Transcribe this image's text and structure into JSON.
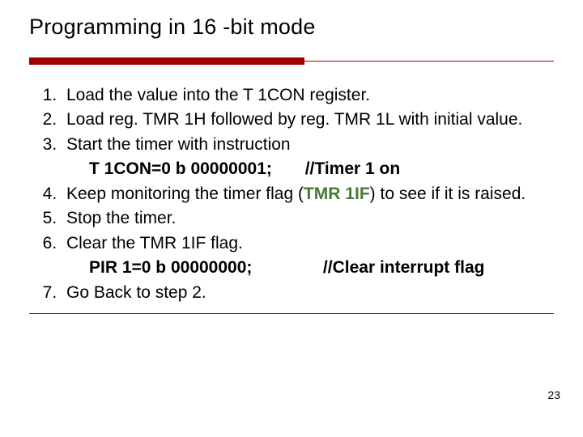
{
  "title": "Programming in 16 -bit mode",
  "steps": {
    "s1": "Load the value into the T 1CON register.",
    "s2": "Load reg. TMR 1H followed by reg. TMR 1L with initial value.",
    "s3": "Start the timer with instruction",
    "s3_code": "T 1CON=0 b 00000001;",
    "s3_comment": "//Timer 1 on",
    "s4_a": "Keep monitoring the timer flag (",
    "s4_flag": "TMR 1IF",
    "s4_b": ") to see if it is raised.",
    "s5": "Stop the timer.",
    "s6": "Clear the TMR 1IF flag.",
    "s6_code": "PIR 1=0 b 00000000;",
    "s6_comment": "//Clear interrupt flag",
    "s7": "Go Back to step 2."
  },
  "page_number": "23"
}
